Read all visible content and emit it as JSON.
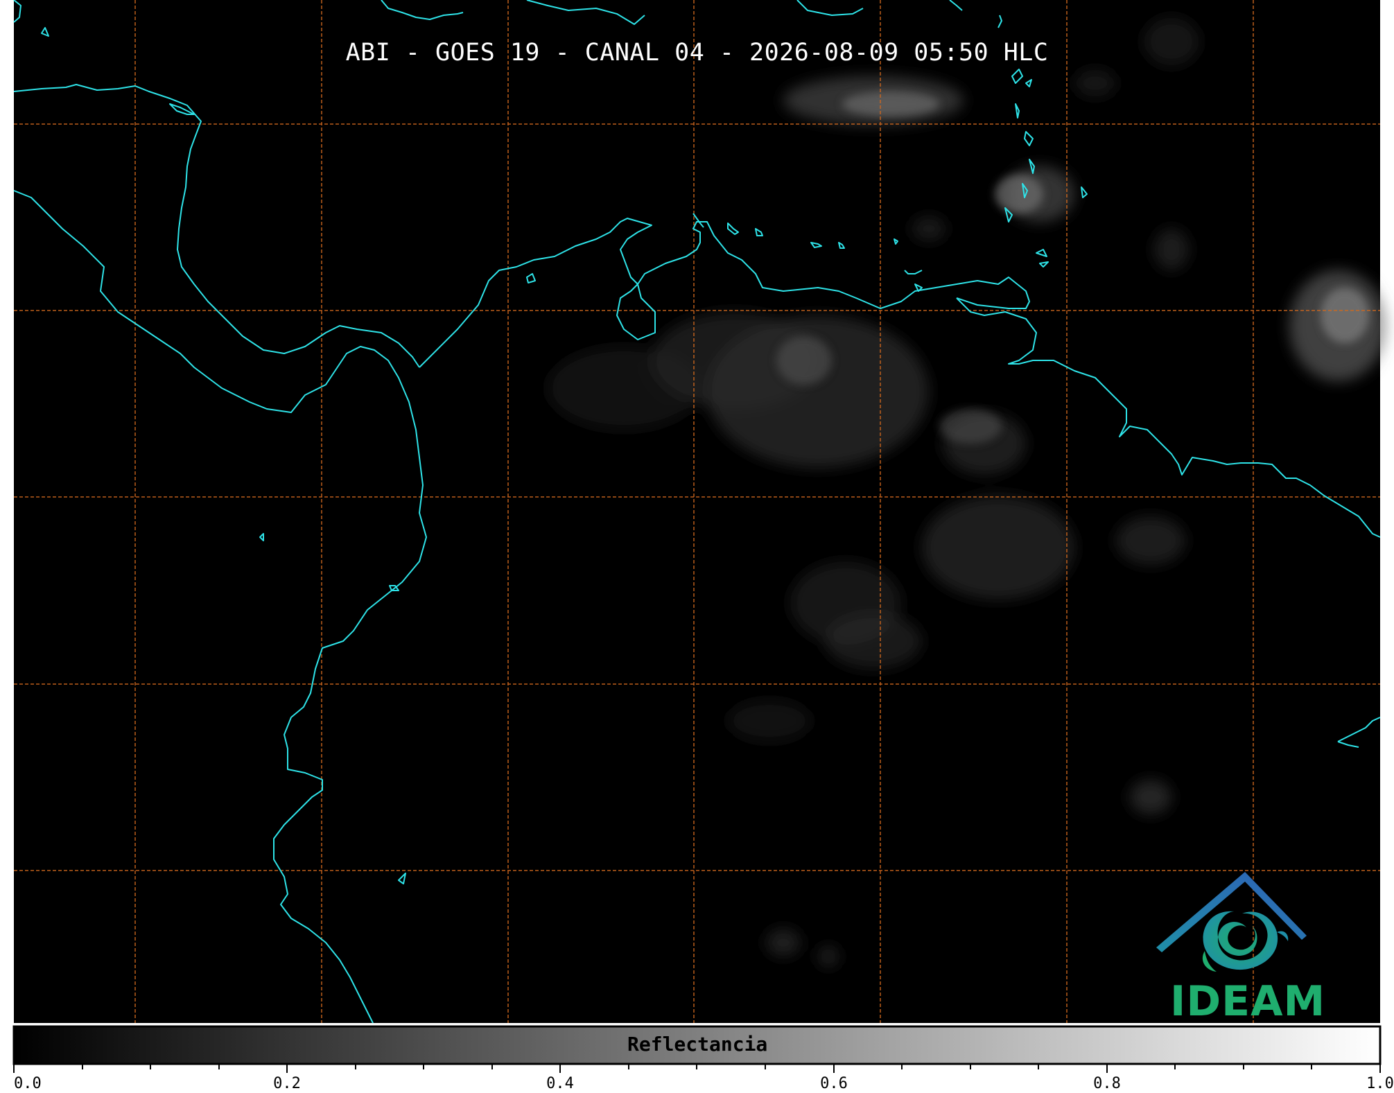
{
  "title": "ABI - GOES 19 - CANAL 04 - 2026-08-09 05:50 HLC",
  "colorbar": {
    "label": "Reflectancia",
    "ticks": [
      "0.0",
      "0.2",
      "0.4",
      "0.6",
      "0.8",
      "1.0"
    ],
    "range": [
      0.0,
      1.0
    ]
  },
  "logo": {
    "text": "IDEAM"
  },
  "colors": {
    "background": "#000000",
    "coastline": "#2ee3e8",
    "gridlines": "#d2691e",
    "logo_blue": "#2f6fb8",
    "logo_green": "#1fae6e"
  }
}
